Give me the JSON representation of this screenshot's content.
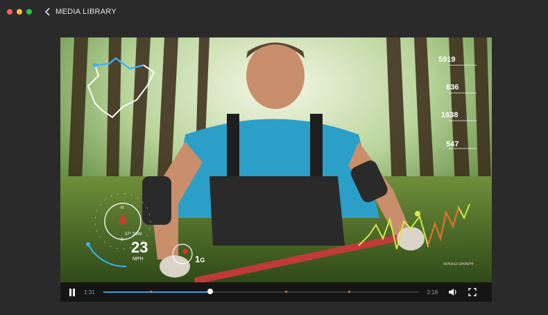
{
  "window": {
    "title": "MEDIA LIBRARY",
    "dots": [
      "#ff5f57",
      "#febc2e",
      "#28c840"
    ]
  },
  "hud": {
    "stats": [
      "5919",
      "836",
      "1638",
      "547"
    ],
    "speed_value": "23",
    "speed_unit": "MPH",
    "heading": "37° SSW",
    "gforce": "1",
    "gforce_unit": "G",
    "speed_graph_label": "SPEED GRAPH",
    "compass_n": "N",
    "compass_s": "S"
  },
  "controls": {
    "current_time": "1:31",
    "total_time": "2:18",
    "progress": 0.34,
    "markers": [
      0.15,
      0.58,
      0.78
    ]
  },
  "icons": {
    "back": "chevron-left-icon",
    "pause": "pause-icon",
    "volume": "volume-icon",
    "fullscreen": "fullscreen-icon"
  }
}
